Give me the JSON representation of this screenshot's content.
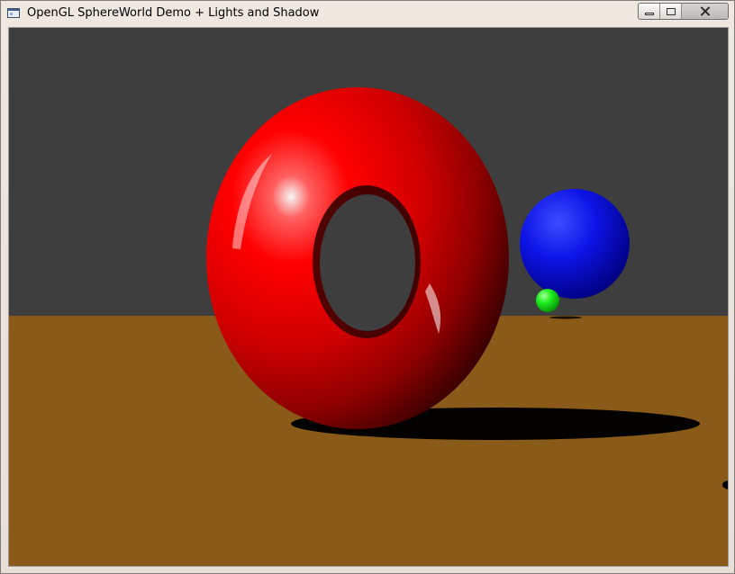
{
  "window": {
    "title": "OpenGL SphereWorld Demo + Lights and Shadow",
    "app_icon": "window-app-icon",
    "controls": {
      "minimize_icon": "minimize-icon",
      "maximize_icon": "maximize-icon",
      "close_icon": "close-icon"
    }
  },
  "scene": {
    "background_color": "#3e3e3e",
    "floor_color": "#8a5a18",
    "objects": [
      {
        "name": "red-torus",
        "color": "#ff0000"
      },
      {
        "name": "blue-sphere",
        "color": "#0000ff"
      },
      {
        "name": "green-sphere",
        "color": "#00ff00"
      }
    ]
  }
}
